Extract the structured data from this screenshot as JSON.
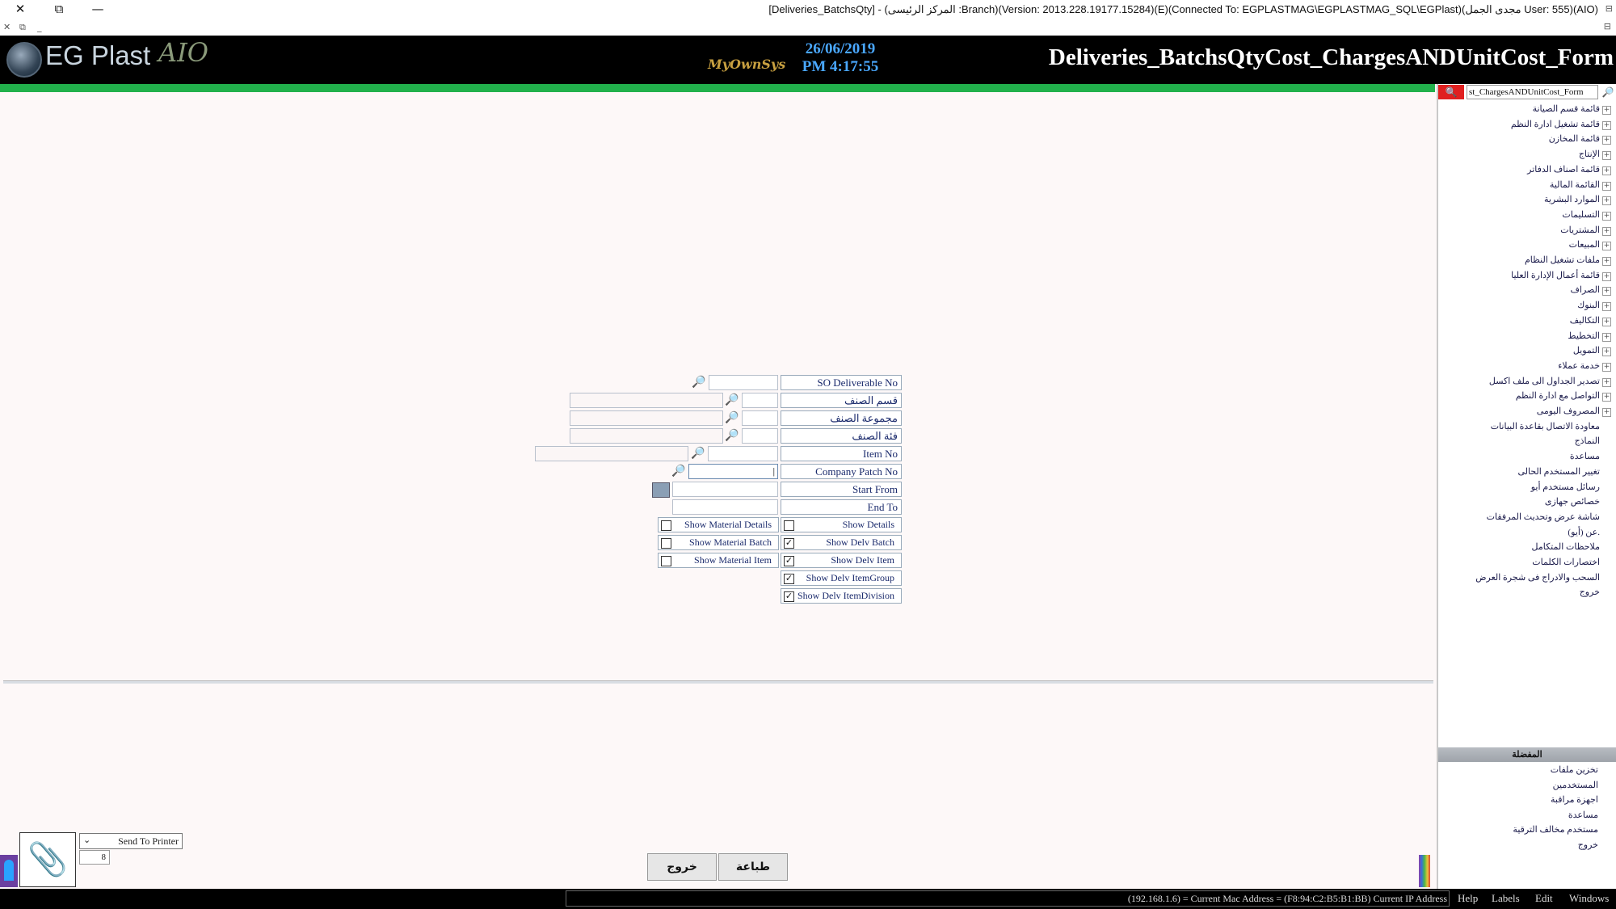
{
  "window": {
    "title": "[Deliveries_BatchsQty] - (المركز الرئيسى :Branch)(Version: 2013.228.19177.15284)(E)(Connected To: EGPLASTMAG\\EGPLASTMAG_SQL\\EGPlast)(مجدى الجمل User: 555)(AIO)",
    "close_glyph": "✕",
    "restore_glyph": "⧉",
    "minimize_glyph": "—",
    "mdi_close": "✕",
    "mdi_restore": "⧉",
    "mdi_min": "_",
    "right_glyph": "⊟"
  },
  "header": {
    "logo_text": "EG Plast",
    "logo_aio": "AIO",
    "mid_logo": "MyOwnSys",
    "date": "26/06/2019",
    "time": "PM 4:17:55",
    "form_title": "Deliveries_BatchsQtyCost_ChargesANDUnitCost_Form"
  },
  "form": {
    "so_deliverable_no": "SO Deliverable No",
    "item_section": "قسم الصنف",
    "item_group": "مجموعة الصنف",
    "item_category": "فئة الصنف",
    "item_no": "Item No",
    "company_patch_no": "Company Patch No",
    "start_from": "Start From",
    "end_to": "End To",
    "company_patch_value": "|",
    "search_glyph": "🔎"
  },
  "checks": {
    "show_details": {
      "label": "Show Details",
      "checked": false
    },
    "show_delv_batch": {
      "label": "Show Delv Batch",
      "checked": true
    },
    "show_delv_item": {
      "label": "Show Delv Item",
      "checked": true
    },
    "show_delv_itemgroup": {
      "label": "Show Delv ItemGroup",
      "checked": true
    },
    "show_delv_itemdivision": {
      "label": "Show Delv ItemDivision",
      "checked": true
    },
    "show_material_details": {
      "label": "Show Material Details",
      "checked": false
    },
    "show_material_batch": {
      "label": "Show Material Batch",
      "checked": false
    },
    "show_material_item": {
      "label": "Show Material Item",
      "checked": false
    },
    "check_glyph": "✓"
  },
  "bottom": {
    "attach_glyph": "📎",
    "printer_option": "Send To Printer",
    "printer_chevron": "⌄",
    "copies": "8",
    "exit_button": "خروج",
    "print_button": "طباعة"
  },
  "right_panel": {
    "search_value": "st_ChargesANDUnitCost_Form",
    "search_btn_glyph": "🔍",
    "search_icon_glyph": "🔎",
    "expand_glyph": "+",
    "tree": [
      "قائمة قسم الصيانة",
      "قائمة تشغيل ادارة النظم",
      "قائمة المخازن",
      "الإنتاج",
      "قائمة اصناف الدفاتر",
      "القائمة المالية",
      "الموارد البشرية",
      "التسليمات",
      "المشتريات",
      "المبيعات",
      "ملفات تشغيل النظام",
      "قائمة أعمال الإدارة العليا",
      "الصراف",
      "البنوك",
      "التكاليف",
      "التخطيط",
      "التمويل",
      "خدمة عملاء",
      "تصدير الجداول الى ملف اكسل",
      "التواصل مع ادارة النظم",
      "المصروف اليومى"
    ],
    "tree_leaves": [
      "معاودة الاتصال بقاعدة البيانات",
      "النماذج",
      "مساعدة",
      "تغيير المستخدم الحالى",
      "رسائل مستخدم أيو",
      "خصائص جهازى",
      "شاشة عرض وتحديث المرفقات",
      "عن (أيو).",
      "ملاحظات المتكامل",
      "اختصارات الكلمات",
      "السحب والادراج فى شجرة العرض",
      "خروج"
    ],
    "favorites_header": "المفضلة",
    "favorites": [
      "تخزين ملفات",
      "المستخدمين",
      "اجهزة مراقبة",
      "مساعدة",
      "مستخدم مخالف الترقية",
      "خروج"
    ]
  },
  "status_bar": {
    "info": "(192.168.1.6) = Current Mac Address = (F8:94:C2:B5:B1:BB) Current IP Address",
    "menu": [
      "Help",
      "Labels",
      "Edit",
      "Windows"
    ]
  },
  "colors": {
    "header_bg": "#000000",
    "green_bar": "#22b14c",
    "date_color": "#4aa8ff",
    "search_red": "#e02020"
  }
}
